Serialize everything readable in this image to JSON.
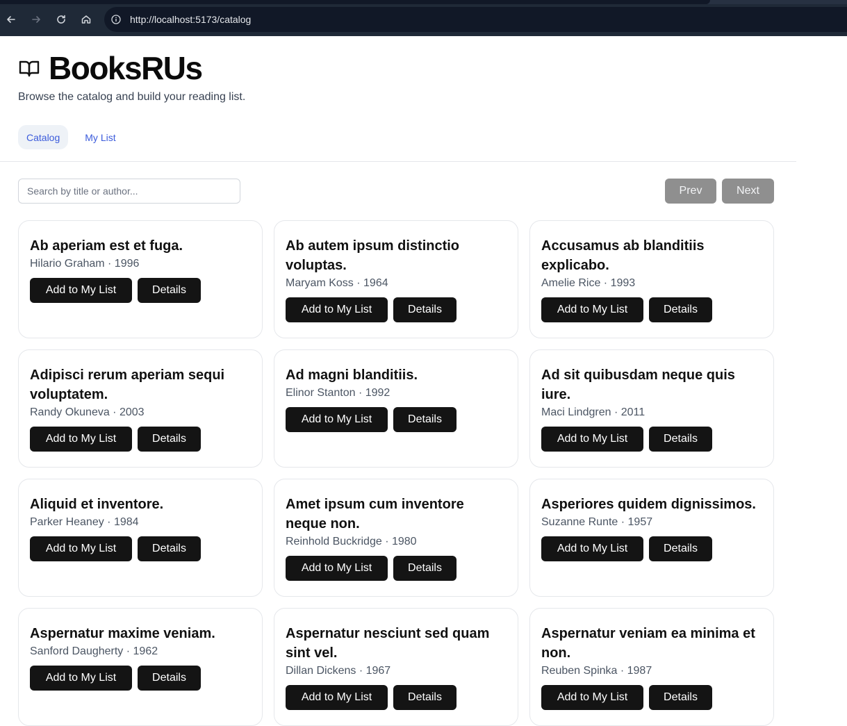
{
  "browser": {
    "url": "http://localhost:5173/catalog",
    "icons": [
      "back-icon",
      "forward-icon",
      "reload-icon",
      "home-icon",
      "info-icon"
    ]
  },
  "header": {
    "logo_icon": "open-book-icon",
    "title": "BooksRUs",
    "tagline": "Browse the catalog and build your reading list."
  },
  "nav": {
    "tabs": [
      {
        "label": "Catalog",
        "active": true
      },
      {
        "label": "My List",
        "active": false
      }
    ]
  },
  "toolbar": {
    "search_placeholder": "Search by title or author...",
    "prev_label": "Prev",
    "next_label": "Next"
  },
  "colors": {
    "accent": "#3b5bdb",
    "button_bg": "#141414",
    "pager_disabled_bg": "#8f8f8f"
  },
  "books": [
    {
      "title": "Ab aperiam est et fuga.",
      "meta": "Hilario Graham · 1996",
      "add_label": "Add to My List",
      "details_label": "Details"
    },
    {
      "title": "Ab autem ipsum distinctio voluptas.",
      "meta": "Maryam Koss · 1964",
      "add_label": "Add to My List",
      "details_label": "Details"
    },
    {
      "title": "Accusamus ab blanditiis explicabo.",
      "meta": "Amelie Rice · 1993",
      "add_label": "Add to My List",
      "details_label": "Details"
    },
    {
      "title": "Adipisci rerum aperiam sequi voluptatem.",
      "meta": "Randy Okuneva · 2003",
      "add_label": "Add to My List",
      "details_label": "Details"
    },
    {
      "title": "Ad magni blanditiis.",
      "meta": "Elinor Stanton · 1992",
      "add_label": "Add to My List",
      "details_label": "Details"
    },
    {
      "title": "Ad sit quibusdam neque quis iure.",
      "meta": "Maci Lindgren · 2011",
      "add_label": "Add to My List",
      "details_label": "Details"
    },
    {
      "title": "Aliquid et inventore.",
      "meta": "Parker Heaney · 1984",
      "add_label": "Add to My List",
      "details_label": "Details"
    },
    {
      "title": "Amet ipsum cum inventore neque non.",
      "meta": "Reinhold Buckridge · 1980",
      "add_label": "Add to My List",
      "details_label": "Details"
    },
    {
      "title": "Asperiores quidem dignissimos.",
      "meta": "Suzanne Runte · 1957",
      "add_label": "Add to My List",
      "details_label": "Details"
    },
    {
      "title": "Aspernatur maxime veniam.",
      "meta": "Sanford Daugherty · 1962",
      "add_label": "Add to My List",
      "details_label": "Details"
    },
    {
      "title": "Aspernatur nesciunt sed quam sint vel.",
      "meta": "Dillan Dickens · 1967",
      "add_label": "Add to My List",
      "details_label": "Details"
    },
    {
      "title": "Aspernatur veniam ea minima et non.",
      "meta": "Reuben Spinka · 1987",
      "add_label": "Add to My List",
      "details_label": "Details"
    }
  ]
}
